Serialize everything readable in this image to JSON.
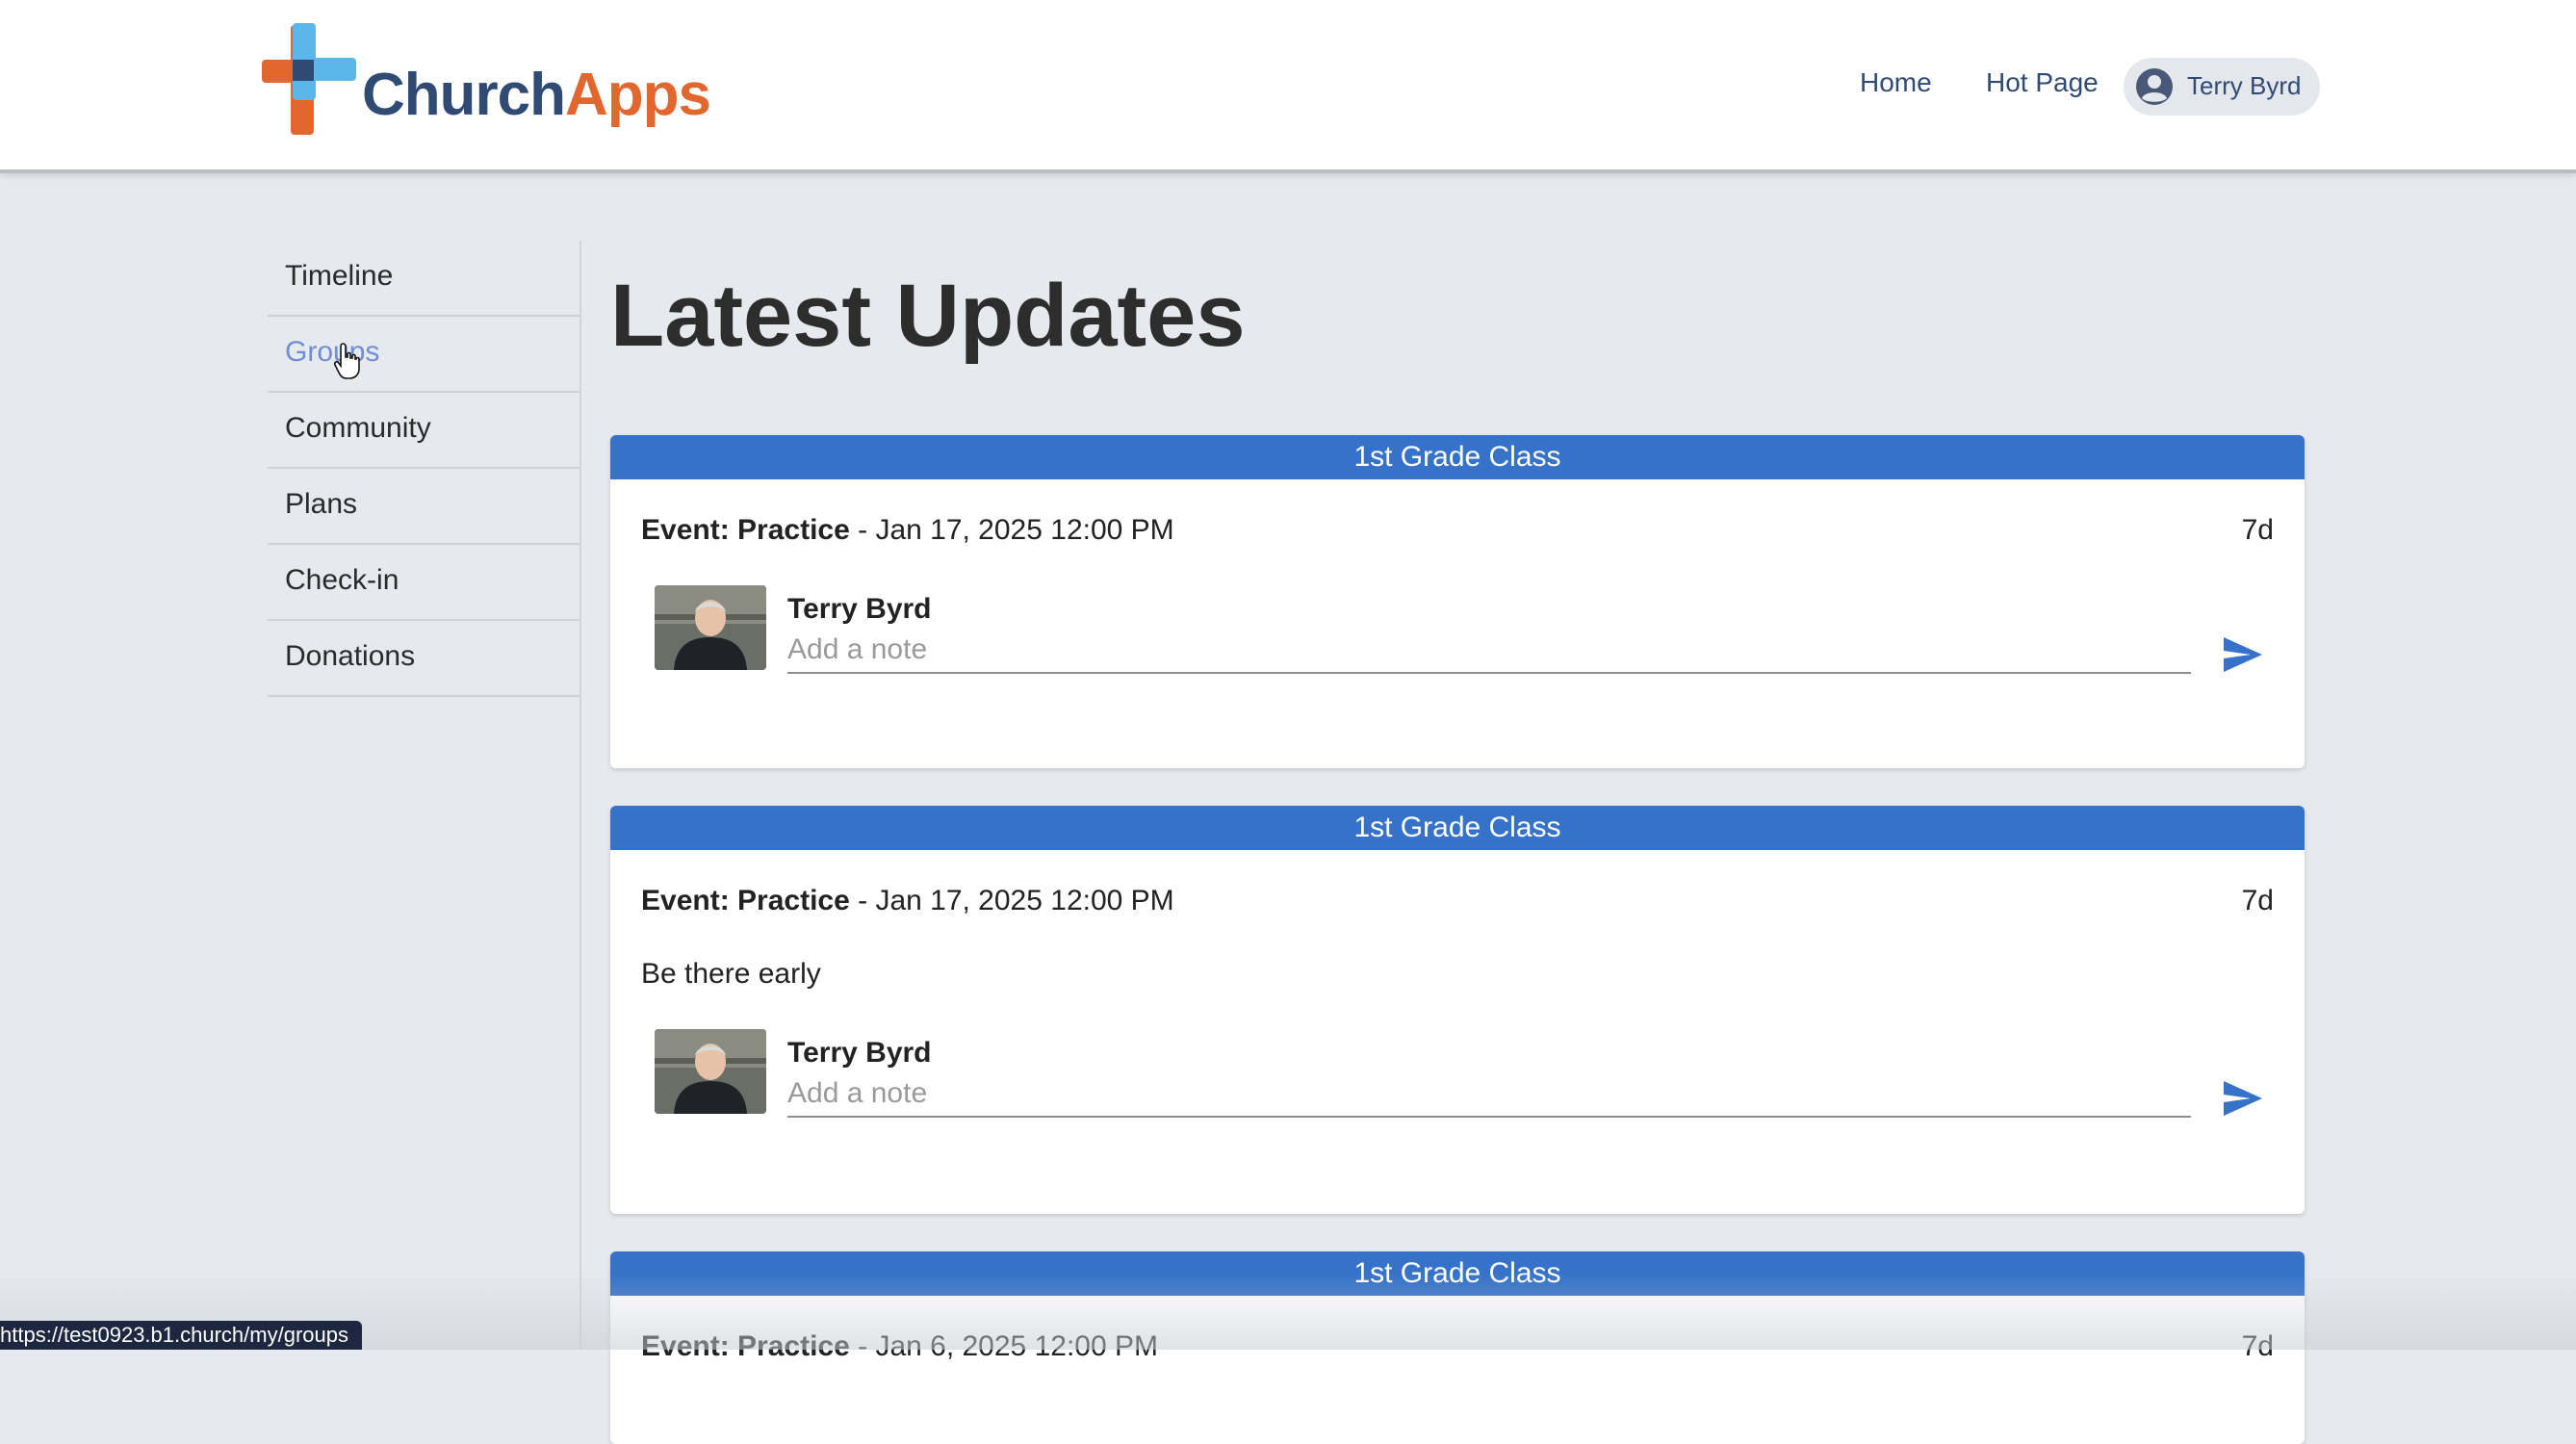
{
  "header": {
    "logo": {
      "part1": "Church",
      "part2": "Apps"
    },
    "nav": [
      {
        "label": "Home"
      },
      {
        "label": "Hot Page"
      }
    ],
    "user": {
      "name": "Terry Byrd",
      "icon": "account-circle-icon"
    }
  },
  "sidebar": {
    "items": [
      {
        "label": "Timeline",
        "active": false
      },
      {
        "label": "Groups",
        "active": true
      },
      {
        "label": "Community",
        "active": false
      },
      {
        "label": "Plans",
        "active": false
      },
      {
        "label": "Check-in",
        "active": false
      },
      {
        "label": "Donations",
        "active": false
      }
    ]
  },
  "main": {
    "title": "Latest Updates",
    "cards": [
      {
        "group": "1st Grade Class",
        "event_label": "Event: Practice",
        "event_date": " - Jan 17, 2025 12:00 PM",
        "age": "7d",
        "description": "",
        "author": "Terry Byrd",
        "note_placeholder": "Add a note"
      },
      {
        "group": "1st Grade Class",
        "event_label": "Event: Practice",
        "event_date": " - Jan 17, 2025 12:00 PM",
        "age": "7d",
        "description": "Be there early",
        "author": "Terry Byrd",
        "note_placeholder": "Add a note"
      },
      {
        "group": "1st Grade Class",
        "event_label": "Event: Practice",
        "event_date": " - Jan 6, 2025 12:00 PM",
        "age": "7d"
      }
    ]
  },
  "status_bar": {
    "url": "https://test0923.b1.church/my/groups"
  },
  "colors": {
    "accent": "#3572c8",
    "brand_blue": "#2f4a73",
    "brand_orange": "#e2672f",
    "active_link": "#6e8fd6",
    "background": "#e6e9ee"
  }
}
